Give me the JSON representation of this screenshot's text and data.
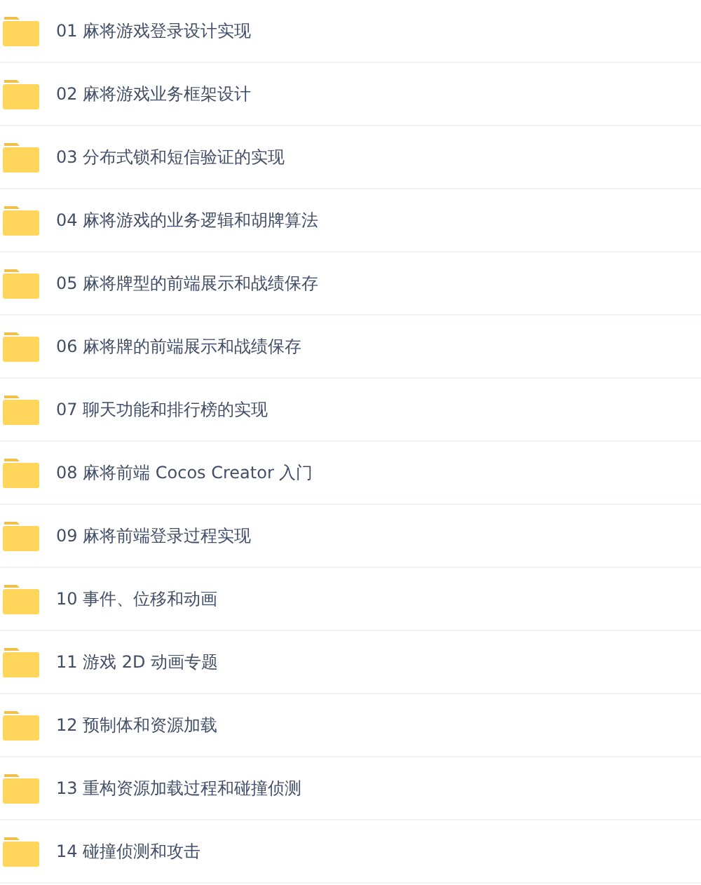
{
  "folders": [
    {
      "name": "01 麻将游戏登录设计实现"
    },
    {
      "name": "02 麻将游戏业务框架设计"
    },
    {
      "name": "03 分布式锁和短信验证的实现"
    },
    {
      "name": "04 麻将游戏的业务逻辑和胡牌算法"
    },
    {
      "name": "05 麻将牌型的前端展示和战绩保存"
    },
    {
      "name": "06 麻将牌的前端展示和战绩保存"
    },
    {
      "name": "07 聊天功能和排行榜的实现"
    },
    {
      "name": "08 麻将前端 Cocos Creator 入门"
    },
    {
      "name": "09 麻将前端登录过程实现"
    },
    {
      "name": "10 事件、位移和动画"
    },
    {
      "name": "11 游戏 2D 动画专题"
    },
    {
      "name": "12 预制体和资源加载"
    },
    {
      "name": "13 重构资源加载过程和碰撞侦测"
    },
    {
      "name": "14 碰撞侦测和攻击"
    }
  ]
}
